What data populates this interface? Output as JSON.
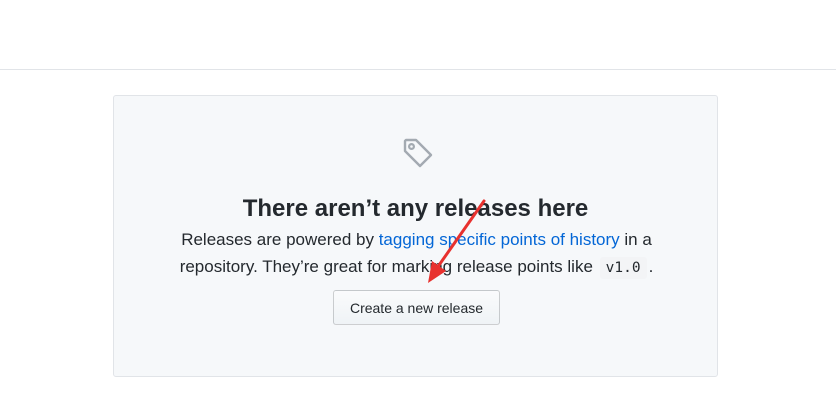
{
  "blankslate": {
    "icon": "tag-icon",
    "title": "There aren’t any releases here",
    "desc_before_link": "Releases are powered by ",
    "link_text": "tagging specific points of history",
    "desc_after_link": " in a repository. They’re great for marking release points like ",
    "code_example": "v1.0",
    "desc_end": ".",
    "button_label": "Create a new release"
  },
  "annotation": {
    "arrow_color": "#e8312e",
    "icon": "arrow-annotation"
  },
  "colors": {
    "link": "#0366d6",
    "text": "#24292e",
    "panel_bg": "#f6f8fa",
    "border": "#e1e4e8"
  }
}
